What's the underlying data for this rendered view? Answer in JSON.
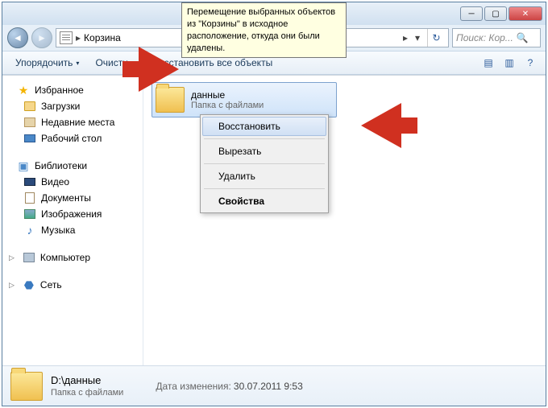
{
  "window": {
    "min": "─",
    "max": "▢",
    "close": "✕"
  },
  "nav": {
    "back": "◄",
    "fwd": "►",
    "breadcrumb": "Корзина",
    "sep": "▸",
    "drop": "▾",
    "refresh": "↻"
  },
  "search": {
    "placeholder": "Поиск: Кор...",
    "icon": "🔍"
  },
  "toolbar": {
    "organize": "Упорядочить",
    "empty": "Очисти...",
    "restore_all": "Восстановить все объекты",
    "drop": "▾",
    "view": "▤",
    "help": "?"
  },
  "tooltip": "Перемещение выбранных объектов из \"Корзины\" в исходное расположение, откуда они были удалены.",
  "sidebar": {
    "favorites": "Избранное",
    "fav_items": [
      "Загрузки",
      "Недавние места",
      "Рабочий стол"
    ],
    "libraries": "Библиотеки",
    "lib_items": [
      "Видео",
      "Документы",
      "Изображения",
      "Музыка"
    ],
    "computer": "Компьютер",
    "network": "Сеть"
  },
  "file": {
    "name": "данные",
    "sub": "Папка с файлами"
  },
  "context": {
    "restore": "Восстановить",
    "cut": "Вырезать",
    "delete": "Удалить",
    "properties": "Свойства"
  },
  "status": {
    "path": "D:\\данные",
    "sub": "Папка с файлами",
    "meta_label": "Дата изменения:",
    "meta_value": "30.07.2011 9:53"
  }
}
